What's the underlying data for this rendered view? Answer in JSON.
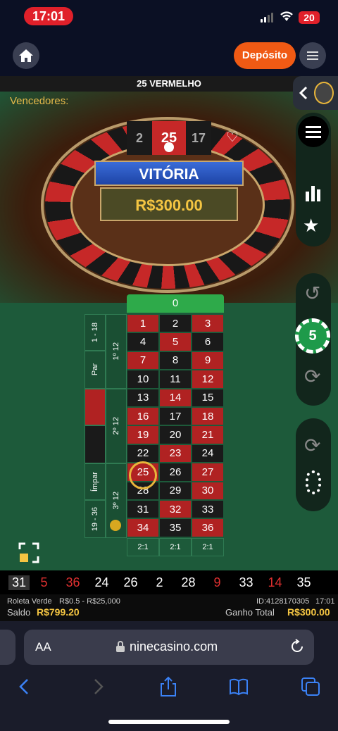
{
  "status": {
    "time": "17:01",
    "battery": "20"
  },
  "header": {
    "deposit_label": "Depósito"
  },
  "game": {
    "result": "25 VERMELHO",
    "winners_label": "Vencedores:",
    "win_title": "VITÓRIA",
    "win_amount": "R$300.00",
    "wheel_top": [
      "2",
      "25",
      "17"
    ],
    "chip_value": "5"
  },
  "table": {
    "zero": "0",
    "rows": [
      [
        [
          "1",
          "red"
        ],
        [
          "2",
          "black"
        ],
        [
          "3",
          "red"
        ]
      ],
      [
        [
          "4",
          "black"
        ],
        [
          "5",
          "red"
        ],
        [
          "6",
          "black"
        ]
      ],
      [
        [
          "7",
          "red"
        ],
        [
          "8",
          "black"
        ],
        [
          "9",
          "red"
        ]
      ],
      [
        [
          "10",
          "black"
        ],
        [
          "11",
          "black"
        ],
        [
          "12",
          "red"
        ]
      ],
      [
        [
          "13",
          "black"
        ],
        [
          "14",
          "red"
        ],
        [
          "15",
          "black"
        ]
      ],
      [
        [
          "16",
          "red"
        ],
        [
          "17",
          "black"
        ],
        [
          "18",
          "red"
        ]
      ],
      [
        [
          "19",
          "red"
        ],
        [
          "20",
          "black"
        ],
        [
          "21",
          "red"
        ]
      ],
      [
        [
          "22",
          "black"
        ],
        [
          "23",
          "red"
        ],
        [
          "24",
          "black"
        ]
      ],
      [
        [
          "25",
          "red"
        ],
        [
          "26",
          "black"
        ],
        [
          "27",
          "red"
        ]
      ],
      [
        [
          "28",
          "black"
        ],
        [
          "29",
          "black"
        ],
        [
          "30",
          "red"
        ]
      ],
      [
        [
          "31",
          "black"
        ],
        [
          "32",
          "red"
        ],
        [
          "33",
          "black"
        ]
      ],
      [
        [
          "34",
          "red"
        ],
        [
          "35",
          "black"
        ],
        [
          "36",
          "red"
        ]
      ]
    ],
    "ratios": [
      "2:1",
      "2:1",
      "2:1"
    ],
    "outside": {
      "low": "1 - 18",
      "even": "Par",
      "odd": "Ímpar",
      "high": "19 - 36"
    },
    "dozens": [
      "1º 12",
      "2º 12",
      "3º 12"
    ]
  },
  "history": [
    {
      "n": "31",
      "c": "#ffffff"
    },
    {
      "n": "5",
      "c": "#e03030"
    },
    {
      "n": "36",
      "c": "#e03030"
    },
    {
      "n": "24",
      "c": "#ffffff"
    },
    {
      "n": "26",
      "c": "#ffffff"
    },
    {
      "n": "2",
      "c": "#ffffff"
    },
    {
      "n": "28",
      "c": "#ffffff"
    },
    {
      "n": "9",
      "c": "#e03030"
    },
    {
      "n": "33",
      "c": "#ffffff"
    },
    {
      "n": "14",
      "c": "#e03030"
    },
    {
      "n": "35",
      "c": "#ffffff"
    }
  ],
  "info": {
    "game_name": "Roleta Verde",
    "limits": "R$0.5 - R$25,000",
    "id": "ID:4128170305",
    "time": "17:01",
    "balance_label": "Saldo",
    "balance": "R$799.20",
    "total_win_label": "Ganho Total",
    "total_win": "R$300.00"
  },
  "browser": {
    "aa": "AA",
    "url": "ninecasino.com"
  }
}
